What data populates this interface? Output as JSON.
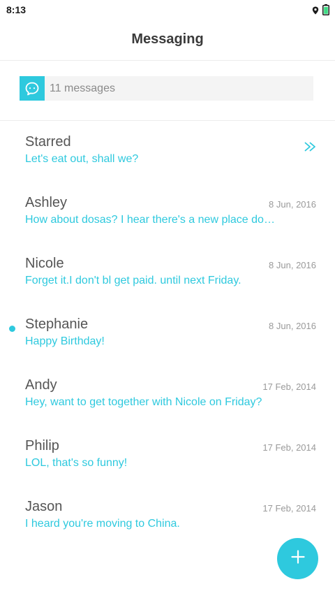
{
  "status_bar": {
    "time": "8:13"
  },
  "header": {
    "title": "Messaging"
  },
  "summary": {
    "text": "11 messages"
  },
  "conversations": [
    {
      "name": "Starred",
      "date": "",
      "preview": "Let's eat out, shall we?"
    },
    {
      "name": "Ashley",
      "date": "8 Jun, 2016",
      "preview": "How about dosas? I hear there's a new place downtown"
    },
    {
      "name": "Nicole",
      "date": "8 Jun, 2016",
      "preview": "Forget it.I don't bl get paid. until next Friday."
    },
    {
      "name": "Stephanie",
      "date": "8 Jun, 2016",
      "preview": "Happy Birthday!",
      "unread": true
    },
    {
      "name": "Andy",
      "date": "17 Feb, 2014",
      "preview": "Hey, want to get together with Nicole on Friday?"
    },
    {
      "name": "Philip",
      "date": "17 Feb, 2014",
      "preview": "LOL, that's so funny!"
    },
    {
      "name": "Jason",
      "date": "17 Feb, 2014",
      "preview": "I heard you're moving to China."
    }
  ],
  "colors": {
    "accent": "#2ec9de",
    "battery": "#3ddc84"
  },
  "icons": {
    "status": [
      "location-icon",
      "battery-icon"
    ],
    "summary": "chat-bubble-icon",
    "starred": "double-chevron-right-icon",
    "fab": "plus-icon"
  }
}
